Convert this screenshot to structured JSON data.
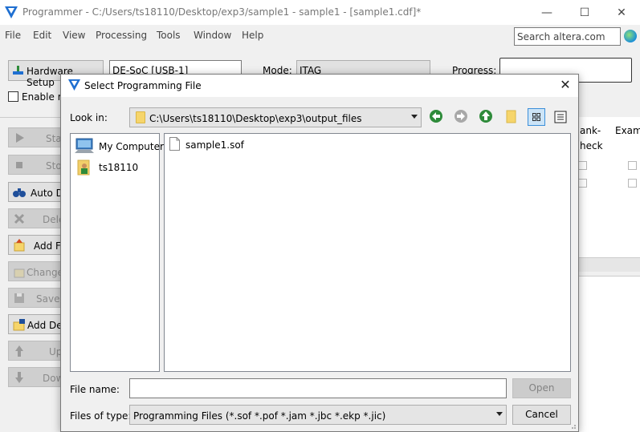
{
  "window": {
    "title": "Programmer - C:/Users/ts18110/Desktop/exp3/sample1 - sample1 - [sample1.cdf]*",
    "minimize_glyph": "—",
    "maximize_glyph": "☐",
    "close_glyph": "✕"
  },
  "menu": {
    "items": [
      "File",
      "Edit",
      "View",
      "Processing",
      "Tools",
      "Window",
      "Help"
    ]
  },
  "search": {
    "value": "Search altera.com"
  },
  "toolbar": {
    "hardware_setup_label": "Hardware Setup",
    "hardware_value": "DE-SoC [USB-1]",
    "mode_label": "Mode:",
    "mode_value": "JTAG",
    "progress_label": "Progress:",
    "enable_label": "Enable re"
  },
  "side_buttons": [
    {
      "label": "Start",
      "disabled": true
    },
    {
      "label": "Stop",
      "disabled": true
    },
    {
      "label": "Auto Detect",
      "disabled": false
    },
    {
      "label": "Delete",
      "disabled": true
    },
    {
      "label": "Add File",
      "disabled": false
    },
    {
      "label": "Change",
      "disabled": true
    },
    {
      "label": "Save",
      "disabled": true
    },
    {
      "label": "Add Device",
      "disabled": false
    },
    {
      "label": "Up",
      "disabled": true
    },
    {
      "label": "Down",
      "disabled": true
    }
  ],
  "right_columns": {
    "blank_check_line1": "ank-",
    "blank_check_line2": "heck",
    "examine": "Exam"
  },
  "dialog": {
    "title": "Select Programming File",
    "close_glyph": "✕",
    "look_in_label": "Look in:",
    "look_in_value": "C:\\Users\\ts18110\\Desktop\\exp3\\output_files",
    "places": [
      {
        "label": "My Computer",
        "icon": "computer-icon"
      },
      {
        "label": "ts18110",
        "icon": "user-folder-icon"
      }
    ],
    "files": [
      {
        "label": "sample1.sof",
        "icon": "file-icon"
      }
    ],
    "file_name_label": "File name:",
    "file_name_value": "",
    "open_label": "Open",
    "file_type_label": "Files of type:",
    "file_type_value": "Programming Files (*.sof *.pof *.jam *.jbc *.ekp *.jic)",
    "cancel_label": "Cancel"
  },
  "colors": {
    "accent_blue": "#1f6fd1",
    "nav_green": "#2e8b3a",
    "folder_yellow": "#f6d56b"
  }
}
